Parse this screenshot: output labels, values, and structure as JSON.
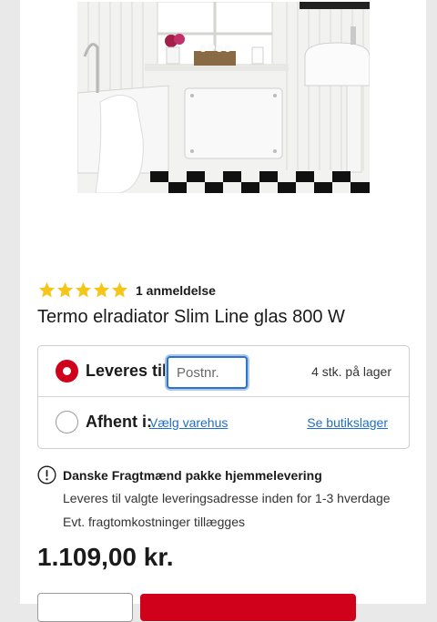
{
  "product": {
    "rating": {
      "stars": 5,
      "reviews_label": "1 anmeldelse"
    },
    "title": "Termo elradiator Slim Line glas 800 W",
    "price": "1.109,00 kr."
  },
  "delivery": {
    "options": [
      {
        "label": "Leveres til:",
        "selected": true
      },
      {
        "label": "Afhent i:",
        "selected": false
      }
    ],
    "postcode_placeholder": "Postnr.",
    "stock_text": "4 stk. på lager",
    "choose_store_link": "Vælg varehus",
    "store_stock_link": "Se butikslager"
  },
  "shipping": {
    "title": "Danske Fragtmænd pakke hjemmelevering",
    "line1": "Leveres til valgte leveringsadresse inden for 1-3 hverdage",
    "line2": "Evt. fragtomkostninger tillægges"
  },
  "colors": {
    "accent": "#d0021b",
    "link": "#1f6fc5",
    "star": "#f5c518",
    "focus": "#2f73c4"
  },
  "icons": [
    "star-icon",
    "info-icon"
  ]
}
